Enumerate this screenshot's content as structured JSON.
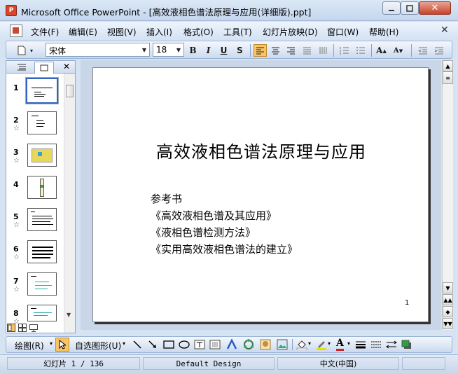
{
  "window": {
    "title": "Microsoft Office PowerPoint - [高效液相色谱法原理与应用(详细版).ppt]",
    "app_icon_label": "P"
  },
  "menu": {
    "items": [
      "文件(F)",
      "编辑(E)",
      "视图(V)",
      "插入(I)",
      "格式(O)",
      "工具(T)",
      "幻灯片放映(D)",
      "窗口(W)",
      "帮助(H)"
    ]
  },
  "formatting": {
    "font_name": "宋体",
    "font_size": "18",
    "bold": "B",
    "italic": "I",
    "underline": "U",
    "shadow": "S"
  },
  "slides_panel": {
    "items": [
      {
        "number": "1",
        "star": ""
      },
      {
        "number": "2",
        "star": "☆"
      },
      {
        "number": "3",
        "star": "☆"
      },
      {
        "number": "4",
        "star": ""
      },
      {
        "number": "5",
        "star": "☆"
      },
      {
        "number": "6",
        "star": "☆"
      },
      {
        "number": "7",
        "star": "☆"
      },
      {
        "number": "8",
        "star": "☆"
      }
    ],
    "selected_index": 0
  },
  "slide": {
    "title": "高效液相色谱法原理与应用",
    "body_lines": [
      "参考书",
      "《高效液相色谱及其应用》",
      "《液相色谱检测方法》",
      "《实用高效液相色谱法的建立》"
    ],
    "page_number": "1"
  },
  "drawing": {
    "draw_label": "绘图(R)",
    "autoshapes_label": "自选图形(U)"
  },
  "status": {
    "slide_info": "幻灯片 1 / 136",
    "design": "Default Design",
    "language": "中文(中国)"
  },
  "colors": {
    "selection": "#3165c1",
    "highlight_button": "#f7c466",
    "title_bar": "#c5d7ee"
  }
}
